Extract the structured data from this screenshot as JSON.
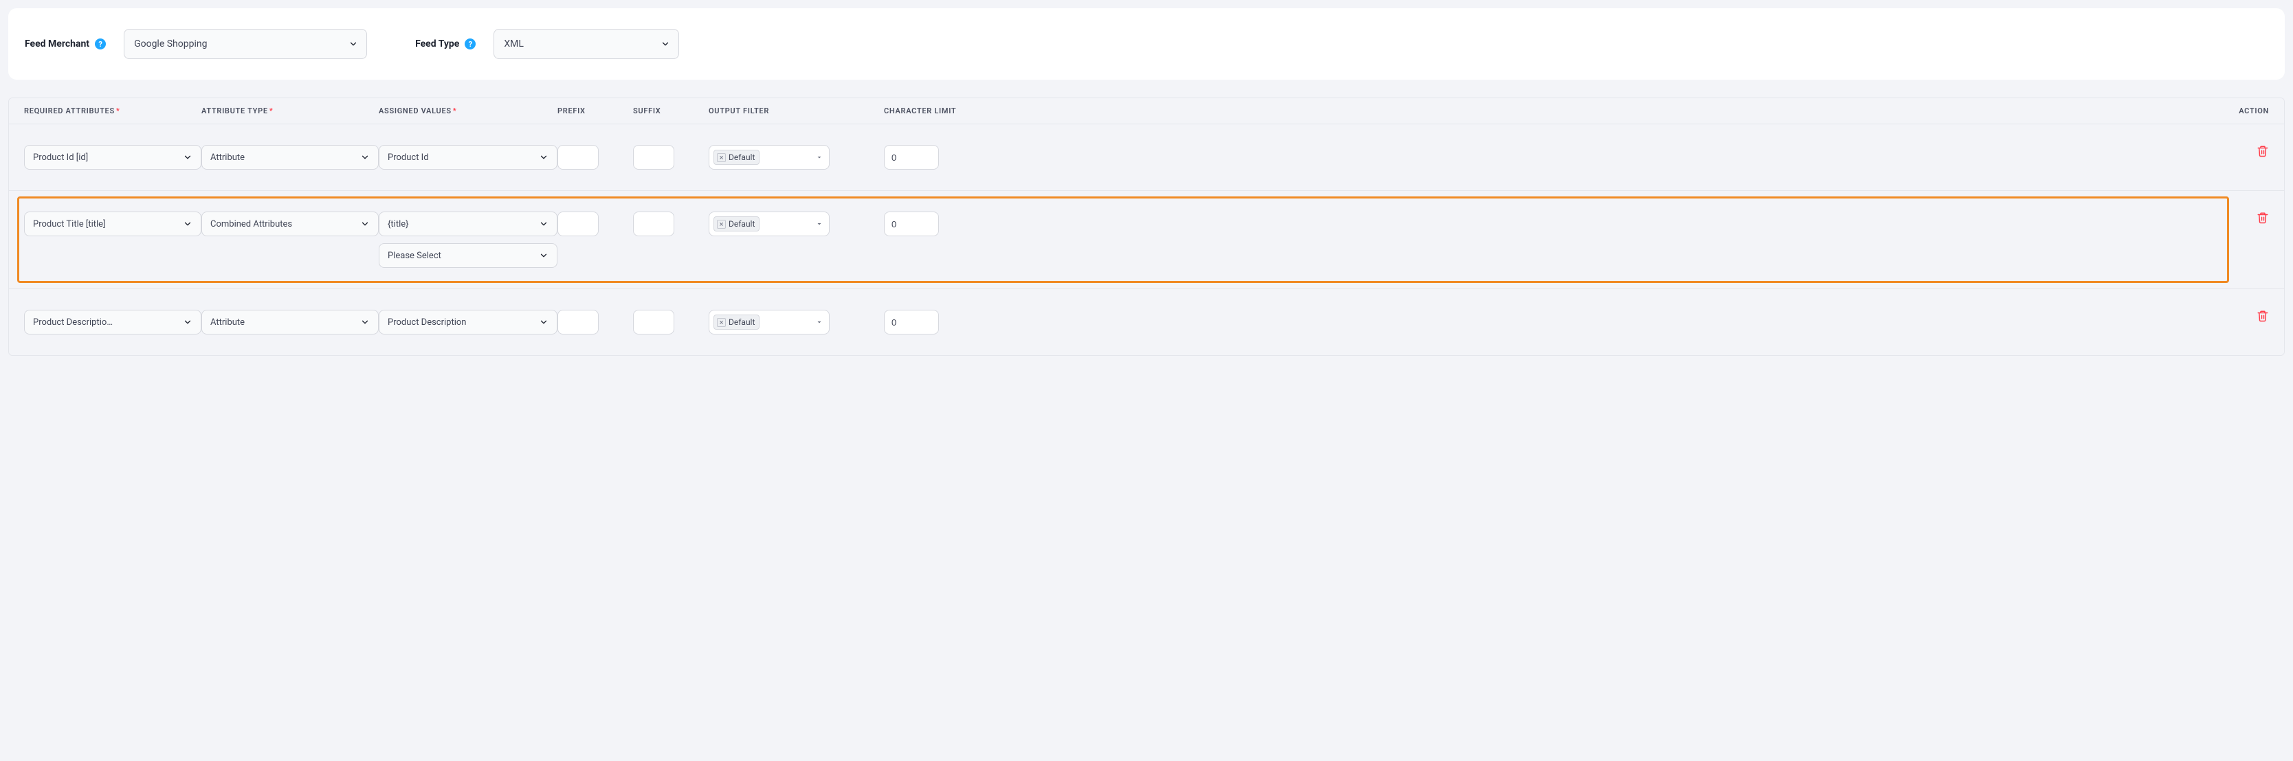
{
  "header": {
    "feed_merchant": {
      "label": "Feed Merchant",
      "value": "Google Shopping"
    },
    "feed_type": {
      "label": "Feed Type",
      "value": "XML"
    }
  },
  "columns": {
    "required": "REQUIRED ATTRIBUTES",
    "type": "ATTRIBUTE TYPE",
    "assigned": "ASSIGNED VALUES",
    "prefix": "PREFIX",
    "suffix": "SUFFIX",
    "filter": "OUTPUT FILTER",
    "charlimit": "CHARACTER LIMIT",
    "action": "ACTION"
  },
  "rows": [
    {
      "req": "Product Id [id]",
      "type": "Attribute",
      "assigned_primary": "Product Id",
      "assigned_secondary": null,
      "prefix": "",
      "suffix": "",
      "filter_chip": "Default",
      "charlimit": "0",
      "highlighted": false
    },
    {
      "req": "Product Title [title]",
      "type": "Combined Attributes",
      "assigned_primary": "{title}",
      "assigned_secondary": "Please Select",
      "prefix": "",
      "suffix": "",
      "filter_chip": "Default",
      "charlimit": "0",
      "highlighted": true
    },
    {
      "req": "Product Description [description]",
      "type": "Attribute",
      "assigned_primary": "Product Description",
      "assigned_secondary": null,
      "prefix": "",
      "suffix": "",
      "filter_chip": "Default",
      "charlimit": "0",
      "highlighted": false
    }
  ]
}
